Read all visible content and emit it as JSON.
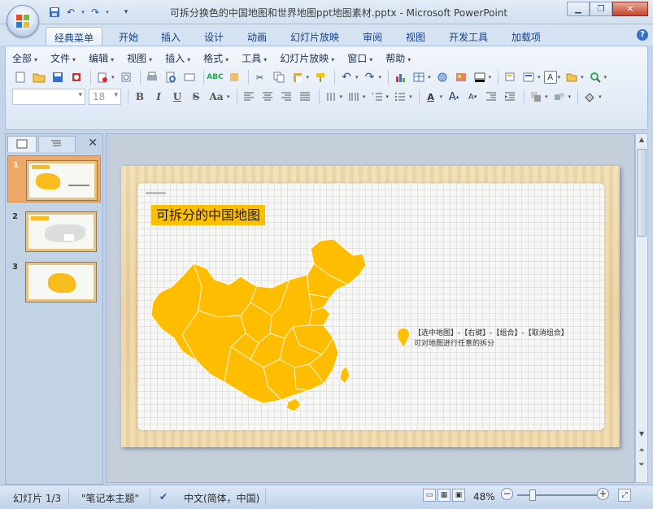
{
  "window": {
    "title": "可拆分换色的中国地图和世界地图ppt地图素材.pptx - Microsoft PowerPoint",
    "controls": [
      "minimize",
      "restore",
      "close"
    ]
  },
  "quick_access": [
    "save-icon",
    "undo-icon",
    "redo-icon",
    "customize-icon"
  ],
  "ribbon_tabs": [
    {
      "label": "经典菜单",
      "active": true
    },
    {
      "label": "开始"
    },
    {
      "label": "插入"
    },
    {
      "label": "设计"
    },
    {
      "label": "动画"
    },
    {
      "label": "幻灯片放映"
    },
    {
      "label": "审阅"
    },
    {
      "label": "视图"
    },
    {
      "label": "开发工具"
    },
    {
      "label": "加载项"
    }
  ],
  "menu": [
    "全部",
    "文件",
    "编辑",
    "视图",
    "插入",
    "格式",
    "工具",
    "幻灯片放映",
    "窗口",
    "帮助"
  ],
  "format": {
    "font_value": "",
    "size_value": "18",
    "bold": "B",
    "italic": "I",
    "underline": "U",
    "strike": "S",
    "case": "Aa"
  },
  "left_pane": {
    "slides": [
      {
        "num": "1",
        "selected": true
      },
      {
        "num": "2",
        "selected": false
      },
      {
        "num": "3",
        "selected": false
      }
    ]
  },
  "slide": {
    "title": "可拆分的中国地图",
    "caption_line1": "【选中地图】-【右键】-【组合】-【取消组合】",
    "caption_line2": "可对地图进行任意的拆分"
  },
  "status": {
    "slide_pos": "幻灯片 1/3",
    "theme": "\"笔记本主题\"",
    "language": "中文(简体，中国)",
    "zoom": "48%"
  },
  "colors": {
    "accent": "#fdc000",
    "map": "#ffbd00",
    "ribbon": "#dbe6f4"
  }
}
